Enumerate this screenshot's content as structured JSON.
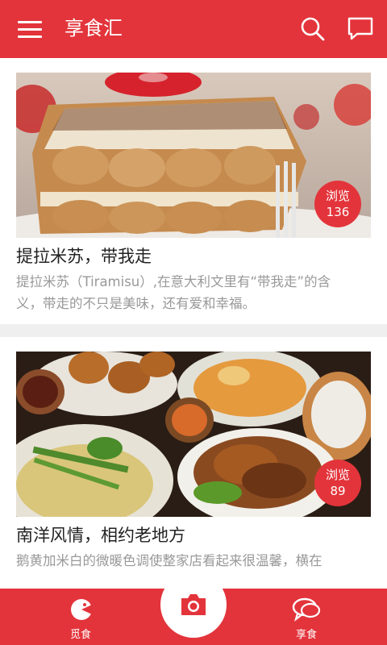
{
  "app": {
    "title": "享食汇"
  },
  "colors": {
    "primary": "#e3343b",
    "text": "#222222",
    "muted": "#999999"
  },
  "header": {
    "icons": [
      "menu-icon",
      "search-icon",
      "chat-bubble-icon"
    ]
  },
  "cards": [
    {
      "title": "提拉米苏，带我走",
      "desc_line1": "提拉米苏（Tiramisu）,在意大利文里有“带我走”的含",
      "desc_line2": "义，带走的不只是美味，还有爱和幸福。",
      "views_label": "浏览",
      "views_count": "136"
    },
    {
      "title": "南洋风情，相约老地方",
      "desc_line1": "鹅黄加米白的微暖色调使整家店看起来很温馨，横在",
      "views_label": "浏览",
      "views_count": "89"
    }
  ],
  "bottom_nav": {
    "left_label": "觅食",
    "right_label": "享食",
    "icons": [
      "pie-chart-icon",
      "camera-icon",
      "chat-bubbles-icon"
    ]
  }
}
